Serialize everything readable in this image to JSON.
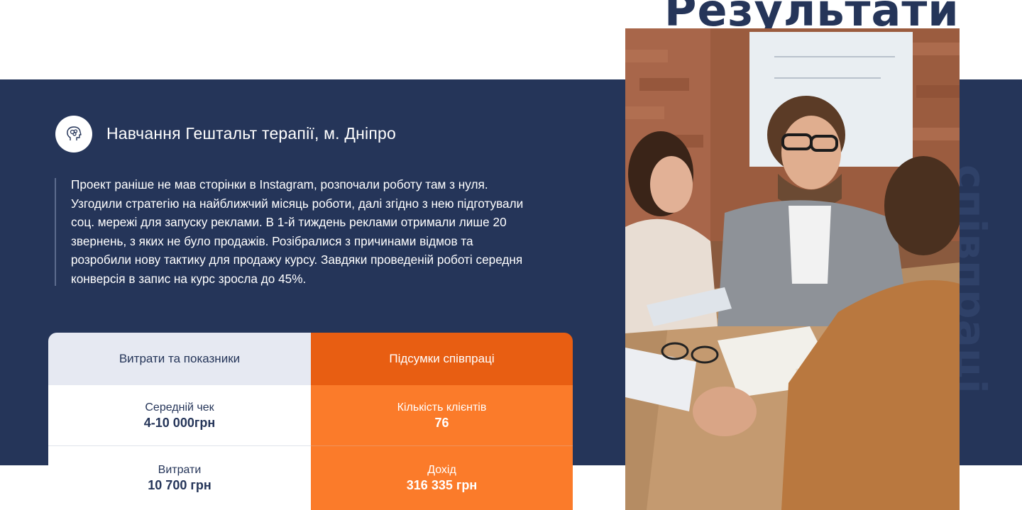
{
  "heading": {
    "top": "Результати",
    "side": "співпраці"
  },
  "case": {
    "title": "Навчання Гештальт терапії, м. Дніпро",
    "icon": "head-brain-icon",
    "description_lines": [
      "Проект раніше не мав сторінки в Instagram, розпочали роботу там з нуля.",
      "Узгодили стратегію на найближчий місяць роботи, далі згідно з нею підготували",
      "соц. мережі для запуску реклами. В 1-й тиждень реклами отримали лише 20",
      "звернень, з яких не було продажів. Розібралися з причинами відмов та",
      "розробили нову тактику для продажу курсу. Завдяки проведеній роботі середня",
      "конверсія в запис на курс зросла до 45%."
    ]
  },
  "table": {
    "left": {
      "header": "Витрати та показники",
      "rows": [
        {
          "label": "Середній чек",
          "value": "4-10 000грн"
        },
        {
          "label": "Витрати",
          "value": "10 700 грн"
        }
      ]
    },
    "right": {
      "header": "Підсумки співпраці",
      "rows": [
        {
          "label": "Кількість клієнтів",
          "value": "76"
        },
        {
          "label": "Дохід",
          "value": "316 335 грн"
        }
      ]
    }
  },
  "colors": {
    "navy": "#253559",
    "orange": "#fb7b2a",
    "orange_dark": "#e85e12",
    "light": "#e6e9f2"
  }
}
